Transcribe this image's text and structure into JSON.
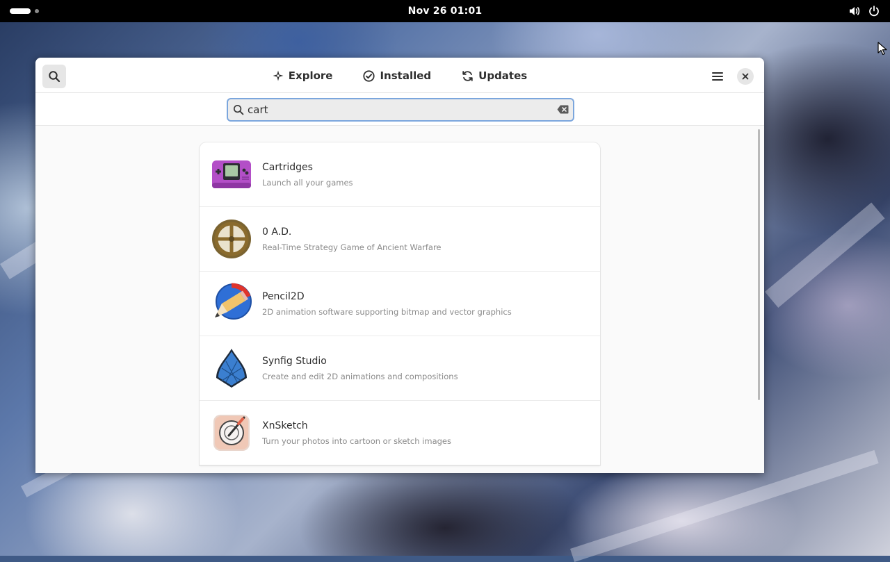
{
  "topbar": {
    "clock": "Nov 26  01:01",
    "icons": [
      "activities-indicator",
      "volume-icon",
      "power-icon"
    ]
  },
  "window": {
    "tabs": [
      {
        "label": "Explore",
        "icon": "explore-icon"
      },
      {
        "label": "Installed",
        "icon": "installed-check-icon"
      },
      {
        "label": "Updates",
        "icon": "updates-refresh-icon"
      }
    ],
    "search": {
      "value": "cart"
    },
    "results": [
      {
        "name": "Cartridges",
        "description": "Launch all your games",
        "icon": "cartridges-handheld-icon",
        "accent": "#b34fc7"
      },
      {
        "name": "0 A.D.",
        "description": "Real-Time Strategy Game of Ancient Warfare",
        "icon": "zero-ad-wheel-icon",
        "accent": "#8a6b2d"
      },
      {
        "name": "Pencil2D",
        "description": "2D animation software supporting bitmap and vector graphics",
        "icon": "pencil2d-icon",
        "accent": "#2f6fd6"
      },
      {
        "name": "Synfig Studio",
        "description": "Create and edit 2D animations and compositions",
        "icon": "synfig-arch-icon",
        "accent": "#2d62b8"
      },
      {
        "name": "XnSketch",
        "description": "Turn your photos into cartoon or sketch images",
        "icon": "xnsketch-icon",
        "accent": "#e0624a"
      }
    ]
  },
  "colors": {
    "topbar": "#000000",
    "window_bg": "#fafafa",
    "search_focus": "#7ba6dd",
    "text_primary": "#2e2e2e",
    "text_secondary": "#8a8a8a"
  }
}
